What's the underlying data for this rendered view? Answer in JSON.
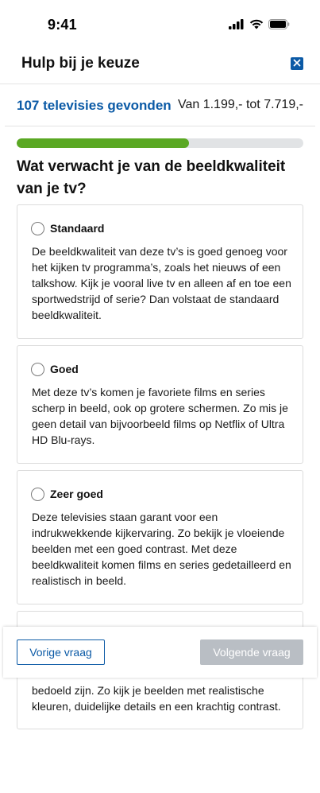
{
  "status_bar": {
    "time": "9:41"
  },
  "header": {
    "title": "Hulp bij je keuze"
  },
  "results": {
    "count": "107 televisies gevonden",
    "price_range": "Van 1.199,- tot 7.719,-"
  },
  "progress": {
    "fraction": 0.6
  },
  "question": {
    "text": "Wat verwacht je van de beeldkwaliteit van je tv?"
  },
  "options": [
    {
      "label": "Standaard",
      "description": "De beeldkwaliteit van deze tv’s is goed genoeg voor het kijken tv programma’s, zoals het nieuws of een talkshow. Kijk je vooral live tv en alleen af en toe een sportwedstrijd of serie? Dan volstaat de standaard beeldkwaliteit."
    },
    {
      "label": "Goed",
      "description": "Met deze tv’s komen je favoriete films en series scherp in beeld, ook op grotere schermen. Zo mis je geen detail van bijvoorbeeld films op Netflix of Ultra HD Blu-rays."
    },
    {
      "label": "Zeer goed",
      "description": "Deze televisies staan garant voor een indrukwekkende kijkervaring. Zo bekijk je vloeiende beelden met een goed contrast. Met deze beeldkwaliteit komen films en series gedetailleerd en realistisch in beeld."
    },
    {
      "label": "",
      "description": "bedoeld zijn. Zo kijk je beelden met realistische kleuren, duidelijke details en een krachtig contrast."
    }
  ],
  "nav": {
    "prev_label": "Vorige vraag",
    "next_label": "Volgende vraag"
  },
  "colors": {
    "accent": "#0b5aa6",
    "progress": "#5aa823",
    "disabled": "#b9bec4"
  },
  "icons": [
    "signal-icon",
    "wifi-icon",
    "battery-icon",
    "close-icon"
  ]
}
